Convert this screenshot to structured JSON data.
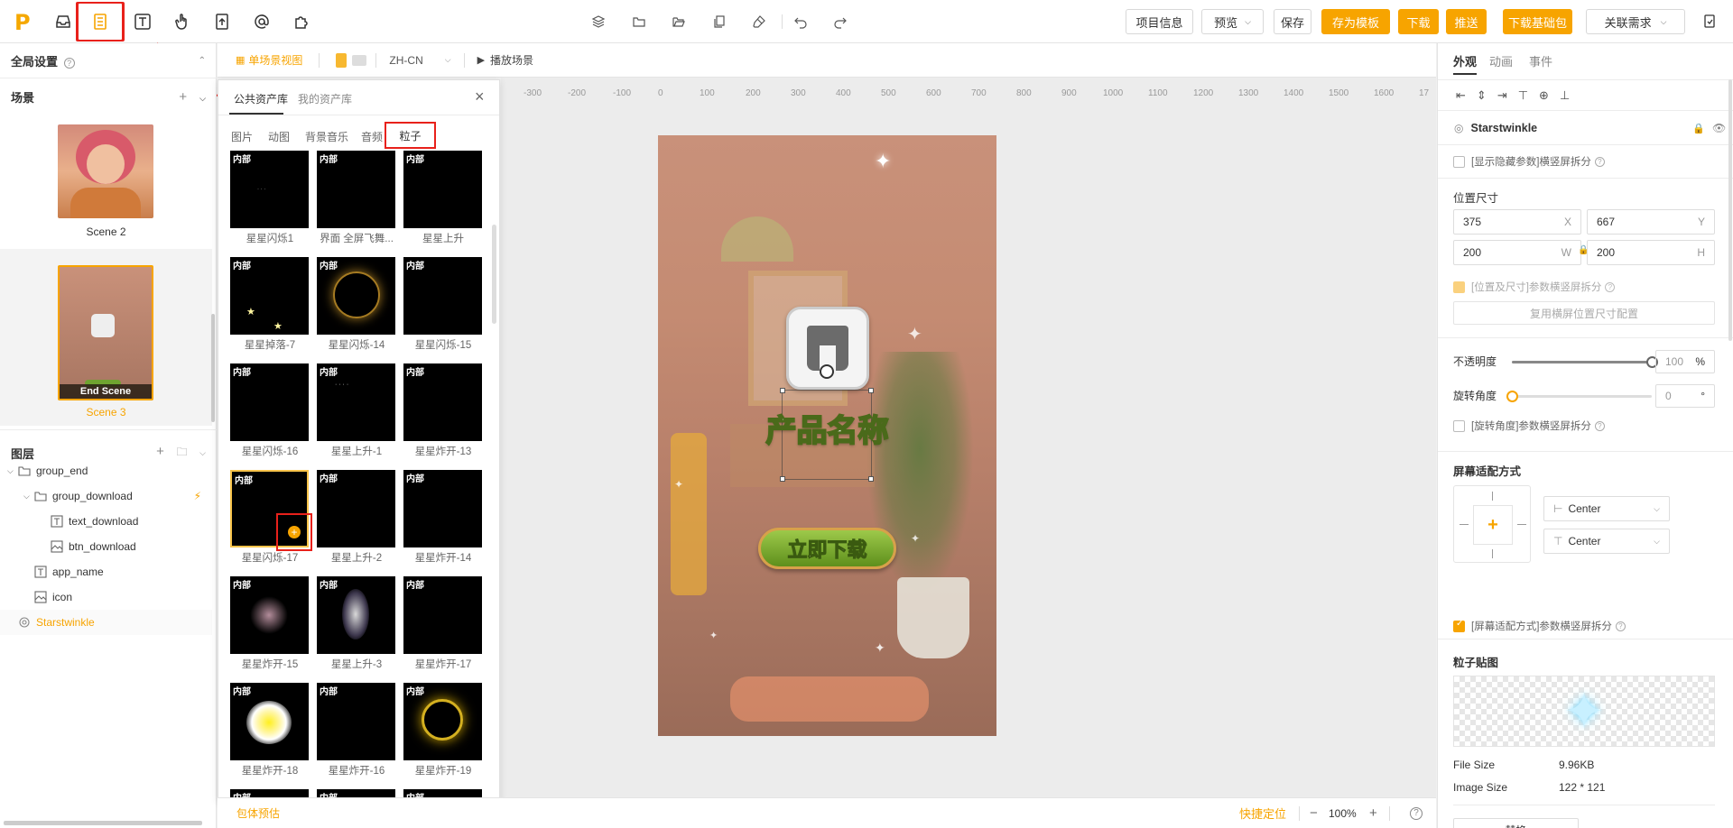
{
  "toolbar": {
    "logo": "P",
    "buttons": {
      "project_info": "项目信息",
      "preview": "预览",
      "save": "保存",
      "save_template": "存为模板",
      "download": "下载",
      "push": "推送",
      "download_base": "下载基础包",
      "link_requirement": "关联需求"
    }
  },
  "subbar": {
    "single_scene_view": "单场景视图",
    "language": "ZH-CN",
    "play_scene": "播放场景"
  },
  "left_panel": {
    "global_settings": "全局设置",
    "scenes_title": "场景",
    "scenes": [
      {
        "name": "Scene 2",
        "active": false
      },
      {
        "name": "Scene 3",
        "active": true,
        "overlay": "End Scene"
      }
    ],
    "layers_title": "图层",
    "layers": [
      {
        "name": "group_end",
        "icon": "folder-icon"
      },
      {
        "name": "group_download",
        "icon": "folder-icon"
      },
      {
        "name": "text_download",
        "icon": "text-icon"
      },
      {
        "name": "btn_download",
        "icon": "image-icon"
      },
      {
        "name": "app_name",
        "icon": "text-icon"
      },
      {
        "name": "icon",
        "icon": "image-icon"
      },
      {
        "name": "Starstwinkle",
        "icon": "particle-icon",
        "selected": true
      }
    ]
  },
  "asset_panel": {
    "tabs": [
      "公共资产库",
      "我的资产库"
    ],
    "active_tab": "公共资产库",
    "subtabs": [
      "图片",
      "动图",
      "背景音乐",
      "音频",
      "粒子"
    ],
    "active_subtab": "粒子",
    "tag": "内部",
    "items": [
      "星星闪烁1",
      "界面 全屏飞舞...",
      "星星上升",
      "星星掉落-7",
      "星星闪烁-14",
      "星星闪烁-15",
      "星星闪烁-16",
      "星星上升-1",
      "星星炸开-13",
      "星星闪烁-17",
      "星星上升-2",
      "星星炸开-14",
      "星星炸开-15",
      "星星上升-3",
      "星星炸开-17",
      "星星炸开-18",
      "星星炸开-16",
      "星星炸开-19"
    ]
  },
  "canvas": {
    "ruler": [
      "-300",
      "-200",
      "-100",
      "0",
      "100",
      "200",
      "300",
      "400",
      "500",
      "600",
      "700",
      "800",
      "900",
      "1000",
      "1100",
      "1200",
      "1300",
      "1400",
      "1500",
      "1600",
      "17"
    ],
    "app_name": "产品名称",
    "download_button": "立即下载"
  },
  "right_panel": {
    "tabs": [
      "外观",
      "动画",
      "事件"
    ],
    "active_tab": "外观",
    "element_name": "Starstwinkle",
    "show_hidden": "[显示隐藏参数]横竖屏拆分",
    "position_size_title": "位置尺寸",
    "x": "375",
    "x_unit": "X",
    "y": "667",
    "y_unit": "Y",
    "w": "200",
    "w_unit": "W",
    "h": "200",
    "h_unit": "H",
    "pos_split": "[位置及尺寸]参数横竖屏拆分",
    "reuse_btn": "复用横屏位置尺寸配置",
    "opacity_label": "不透明度",
    "opacity_value": "100",
    "opacity_unit": "%",
    "opacity_fraction": 1.0,
    "rotation_label": "旋转角度",
    "rotation_value": "0",
    "rotation_unit": "°",
    "rotation_split": "[旋转角度]参数横竖屏拆分",
    "screen_adapt_title": "屏幕适配方式",
    "h_align": "Center",
    "v_align": "Center",
    "screen_split": "[屏幕适配方式]参数横竖屏拆分",
    "particle_map_title": "粒子贴图",
    "file_size_label": "File Size",
    "file_size": "9.96KB",
    "image_size_label": "Image Size",
    "image_size": "122 * 121",
    "replace_btn": "替换"
  },
  "bottombar": {
    "package_estimate": "包体预估",
    "quick_locate": "快捷定位",
    "zoom": "100%"
  },
  "colors": {
    "accent": "#f7a400",
    "highlight_red": "#e8211b"
  }
}
